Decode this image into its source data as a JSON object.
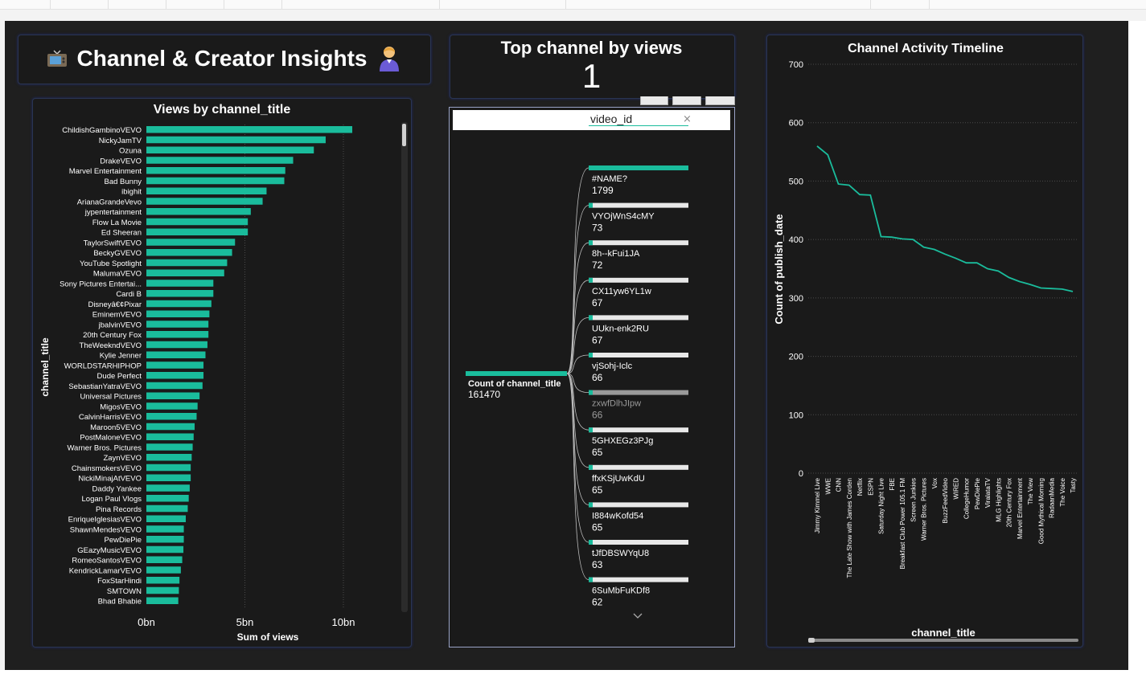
{
  "header": {
    "title": "Channel & Creator Insights",
    "left_icon": "tv-icon",
    "right_icon": "person-icon"
  },
  "kpi": {
    "title": "Top channel by views",
    "value": "1"
  },
  "colors": {
    "accent": "#1abc9c",
    "background": "#1f1f1f",
    "card": "#1a1a1a",
    "bar_bg": "#e8e8e8"
  },
  "decomposition": {
    "field_label": "video_id",
    "clear_icon": "×",
    "root": {
      "label": "Count of channel_title",
      "value": "161470"
    },
    "items": [
      {
        "label": "#NAME?",
        "value": "1799",
        "fraction": 1.0
      },
      {
        "label": "VYOjWnS4cMY",
        "value": "73",
        "fraction": 0.04
      },
      {
        "label": "8h--kFui1JA",
        "value": "72",
        "fraction": 0.04
      },
      {
        "label": "CX11yw6YL1w",
        "value": "67",
        "fraction": 0.037
      },
      {
        "label": "UUkn-enk2RU",
        "value": "67",
        "fraction": 0.037
      },
      {
        "label": "vjSohj-Iclc",
        "value": "66",
        "fraction": 0.037
      },
      {
        "label": "zxwfDlhJIpw",
        "value": "66",
        "fraction": 0.037,
        "muted": true
      },
      {
        "label": "5GHXEGz3PJg",
        "value": "65",
        "fraction": 0.036
      },
      {
        "label": "ffxKSjUwKdU",
        "value": "65",
        "fraction": 0.036
      },
      {
        "label": "I884wKofd54",
        "value": "65",
        "fraction": 0.036
      },
      {
        "label": "tJfDBSWYqU8",
        "value": "63",
        "fraction": 0.035
      },
      {
        "label": "6SuMbFuKDf8",
        "value": "62",
        "fraction": 0.034
      }
    ]
  },
  "chart_data": [
    {
      "type": "bar",
      "orientation": "horizontal",
      "title": "Views by channel_title",
      "xlabel": "Sum of views",
      "ylabel": "channel_title",
      "xlim": [
        0,
        12
      ],
      "x_ticks": [
        0,
        5,
        10
      ],
      "x_tick_labels": [
        "0bn",
        "5bn",
        "10bn"
      ],
      "grid": true,
      "categories": [
        "ChildishGambinoVEVO",
        "NickyJamTV",
        "Ozuna",
        "DrakeVEVO",
        "Marvel Entertainment",
        "Bad Bunny",
        "ibighit",
        "ArianaGrandeVevo",
        "jypentertainment",
        "Flow La Movie",
        "Ed Sheeran",
        "TaylorSwiftVEVO",
        "BeckyGVEVO",
        "YouTube Spotlight",
        "MalumaVEVO",
        "Sony Pictures Entertai...",
        "Cardi B",
        "Disneyâ€¢Pixar",
        "EminemVEVO",
        "jbalvinVEVO",
        "20th Century Fox",
        "TheWeekndVEVO",
        "Kylie Jenner",
        "WORLDSTARHIPHOP",
        "Dude Perfect",
        "SebastianYatraVEVO",
        "Universal Pictures",
        "MigosVEVO",
        "CalvinHarrisVEVO",
        "Maroon5VEVO",
        "PostMaloneVEVO",
        "Warner Bros. Pictures",
        "ZaynVEVO",
        "ChainsmokersVEVO",
        "NickiMinajAtVEVO",
        "Daddy Yankee",
        "Logan Paul Vlogs",
        "Pina Records",
        "EnriqueIglesiasVEVO",
        "ShawnMendesVEVO",
        "PewDiePie",
        "GEazyMusicVEVO",
        "RomeoSantosVEVO",
        "KendrickLamarVEVO",
        "FoxStarHindi",
        "SMTOWN",
        "Bhad Bhabie"
      ],
      "values": [
        10.45,
        9.1,
        8.5,
        7.45,
        7.05,
        7.0,
        6.1,
        5.9,
        5.3,
        5.15,
        5.15,
        4.5,
        4.35,
        4.1,
        3.95,
        3.4,
        3.4,
        3.3,
        3.2,
        3.15,
        3.15,
        3.1,
        3.0,
        2.9,
        2.9,
        2.85,
        2.7,
        2.6,
        2.55,
        2.45,
        2.4,
        2.35,
        2.3,
        2.25,
        2.25,
        2.2,
        2.15,
        2.1,
        2.0,
        1.9,
        1.9,
        1.88,
        1.82,
        1.75,
        1.68,
        1.65,
        1.62
      ]
    },
    {
      "type": "line",
      "title": "Channel Activity Timeline",
      "xlabel": "channel_title",
      "ylabel": "Count of publish_date",
      "ylim": [
        0,
        700
      ],
      "y_ticks": [
        0,
        100,
        200,
        300,
        400,
        500,
        600,
        700
      ],
      "grid": true,
      "categories": [
        "Jimmy Kimmel Live",
        "WWE",
        "CNN",
        "The Late Show with James Corden",
        "Netflix",
        "ESPN",
        "Saturday Night Live",
        "FBE",
        "Breakfast Club Power 105.1 FM",
        "Screen Junkies",
        "Warner Bros. Pictures",
        "Vox",
        "BuzzFeedVideo",
        "WIRED",
        "CollegeHumor",
        "PewDiePie",
        "ViralataTV",
        "MLG Highlights",
        "20th Century Fox",
        "Marvel Entertainment",
        "The View",
        "Good Mythical Morning",
        "RadaanMedia",
        "The Voice",
        "Tasty"
      ],
      "values": [
        560,
        545,
        495,
        493,
        477,
        476,
        405,
        404,
        401,
        400,
        387,
        383,
        375,
        368,
        360,
        360,
        350,
        346,
        335,
        328,
        323,
        317,
        316,
        315,
        311
      ]
    }
  ]
}
